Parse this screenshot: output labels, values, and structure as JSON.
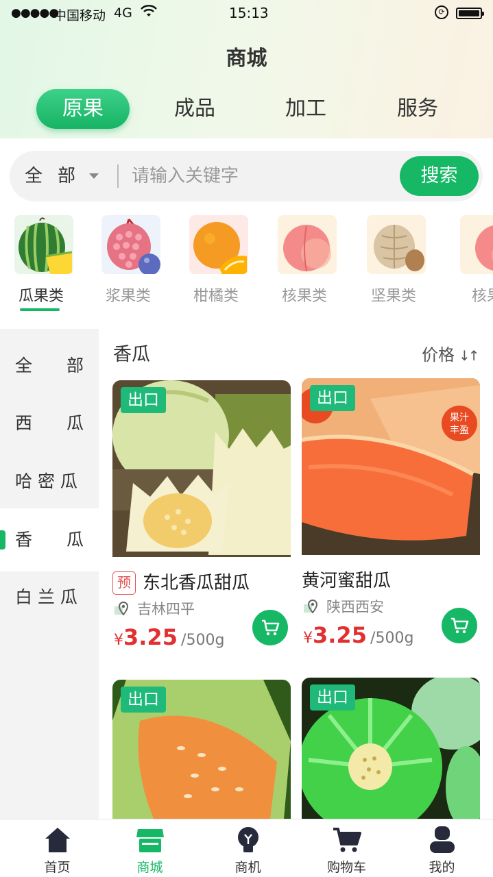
{
  "status_bar": {
    "signal": "●●●●●",
    "carrier": "中国移动",
    "network": "4G",
    "time": "15:13"
  },
  "header": {
    "title": "商城"
  },
  "tabs": [
    {
      "label": "原果",
      "active": true
    },
    {
      "label": "成品",
      "active": false
    },
    {
      "label": "加工",
      "active": false
    },
    {
      "label": "服务",
      "active": false
    }
  ],
  "search": {
    "scope": "全部",
    "placeholder": "请输入关键字",
    "button": "搜索"
  },
  "categories": [
    {
      "label": "瓜果类",
      "icon": "watermelon-icon",
      "active": true
    },
    {
      "label": "浆果类",
      "icon": "raspberry-icon",
      "active": false
    },
    {
      "label": "柑橘类",
      "icon": "orange-icon",
      "active": false
    },
    {
      "label": "核果类",
      "icon": "peach-icon",
      "active": false
    },
    {
      "label": "坚果类",
      "icon": "walnut-icon",
      "active": false
    },
    {
      "label": "核果",
      "icon": "peach-icon",
      "active": false
    }
  ],
  "sidebar": {
    "items": [
      {
        "label": "全　　部",
        "active": false
      },
      {
        "label": "西　　瓜",
        "active": false
      },
      {
        "label": "哈 密 瓜",
        "active": false
      },
      {
        "label": "香　　瓜",
        "active": true
      },
      {
        "label": "白 兰 瓜",
        "active": false
      }
    ]
  },
  "section": {
    "title": "香瓜",
    "sort_label": "价格",
    "sort_icon": "sort-icon"
  },
  "products": [
    {
      "badge": "出口",
      "pre_tag": "预",
      "name": "东北香瓜甜瓜",
      "location": "吉林四平",
      "currency": "¥",
      "price": "3.25",
      "unit": "/500g"
    },
    {
      "badge": "出口",
      "name": "黄河蜜甜瓜",
      "location": "陕西西安",
      "currency": "¥",
      "price": "3.25",
      "unit": "/500g",
      "image_text": [
        "果汁",
        "丰盈"
      ]
    },
    {
      "badge": "出口"
    },
    {
      "badge": "出口"
    }
  ],
  "bottom_nav": [
    {
      "label": "首页",
      "icon": "home-icon",
      "active": false
    },
    {
      "label": "商城",
      "icon": "store-icon",
      "active": true
    },
    {
      "label": "商机",
      "icon": "bulb-icon",
      "active": false
    },
    {
      "label": "购物车",
      "icon": "cart-icon",
      "active": false
    },
    {
      "label": "我的",
      "icon": "user-icon",
      "active": false
    }
  ],
  "colors": {
    "accent": "#16b866",
    "price": "#e23030",
    "badge": "#1fb97a"
  }
}
